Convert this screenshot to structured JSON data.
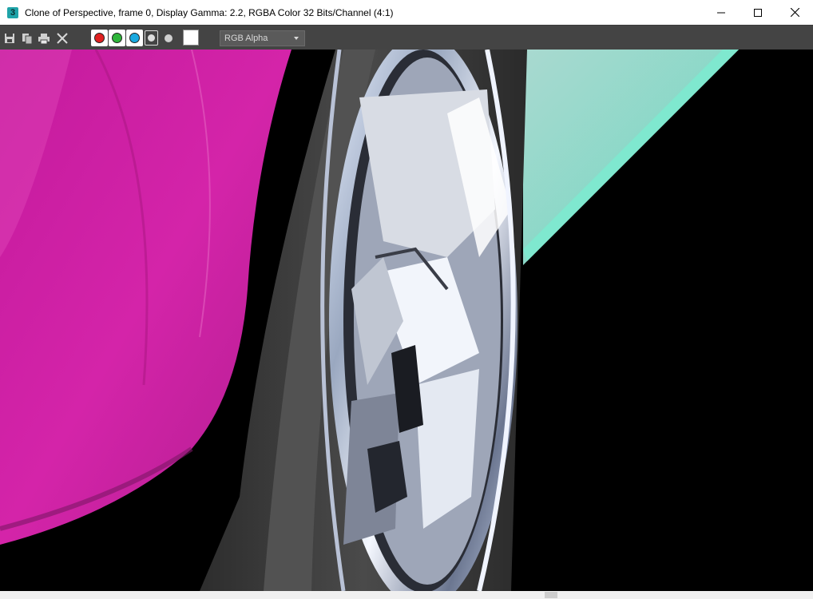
{
  "window": {
    "title": "Clone of Perspective, frame 0, Display Gamma: 2.2, RGBA Color 32 Bits/Channel (4:1)",
    "app_icon_label": "3",
    "controls": {
      "minimize": "minimize-icon",
      "maximize": "maximize-icon",
      "close": "close-icon"
    }
  },
  "toolbar": {
    "icons": [
      "save-icon",
      "copy-icon",
      "print-icon",
      "clear-icon"
    ],
    "channels": [
      {
        "name": "red-channel",
        "color": "#e02020"
      },
      {
        "name": "green-channel",
        "color": "#2fb53a"
      },
      {
        "name": "blue-channel",
        "color": "#19a9e0"
      }
    ],
    "swatch_color": "#ffffff",
    "channel_display": "RGB Alpha"
  },
  "colors": {
    "title_bg": "#ffffff",
    "toolbar_bg": "#444444",
    "render_magenta": "#d21ea8",
    "render_teal": "#8fe3cf",
    "render_tire": "#3c3c3c"
  }
}
